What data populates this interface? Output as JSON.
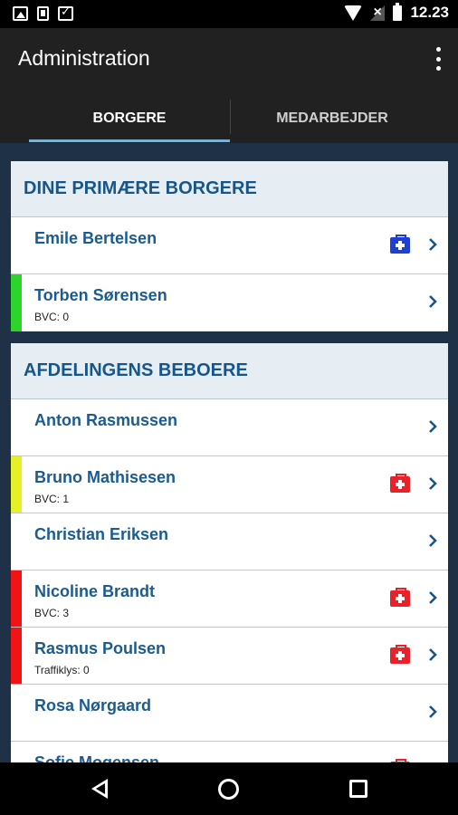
{
  "status_bar": {
    "time": "12.23",
    "icons": [
      "image-icon",
      "document-icon",
      "check-icon",
      "wifi-icon",
      "no-signal-icon",
      "battery-icon"
    ]
  },
  "app_bar": {
    "title": "Administration",
    "menu_icon": "overflow-menu-icon"
  },
  "tabs": [
    {
      "label": "BORGERE",
      "selected": true
    },
    {
      "label": "MEDARBEJDER",
      "selected": false
    }
  ],
  "colors": {
    "flag_green": "#2bd52b",
    "flag_yellow": "#e6f026",
    "flag_red": "#f21414",
    "medkit_blue": "#1f3fd0",
    "medkit_red": "#e8222a",
    "accent": "#17568a"
  },
  "sections": [
    {
      "title": "DINE PRIMÆRE BORGERE",
      "rows": [
        {
          "name": "Emile Bertelsen",
          "sub": "",
          "flag": "",
          "medkit": "blue"
        },
        {
          "name": "Torben Sørensen",
          "sub": "BVC: 0",
          "flag": "green",
          "medkit": ""
        }
      ]
    },
    {
      "title": "AFDELINGENS BEBOERE",
      "rows": [
        {
          "name": "Anton Rasmussen",
          "sub": "",
          "flag": "",
          "medkit": ""
        },
        {
          "name": "Bruno Mathisesen",
          "sub": "BVC: 1",
          "flag": "yellow",
          "medkit": "red"
        },
        {
          "name": "Christian Eriksen",
          "sub": "",
          "flag": "",
          "medkit": ""
        },
        {
          "name": "Nicoline Brandt",
          "sub": "BVC: 3",
          "flag": "red",
          "medkit": "red"
        },
        {
          "name": "Rasmus Poulsen",
          "sub": "Traffiklys: 0",
          "flag": "red",
          "medkit": "red"
        },
        {
          "name": "Rosa Nørgaard",
          "sub": "",
          "flag": "",
          "medkit": ""
        },
        {
          "name": "Sofie Mogensen",
          "sub": "",
          "flag": "",
          "medkit": "red"
        }
      ]
    }
  ],
  "nav_bar": {
    "icons": [
      "back-icon",
      "home-icon",
      "recent-apps-icon"
    ]
  }
}
